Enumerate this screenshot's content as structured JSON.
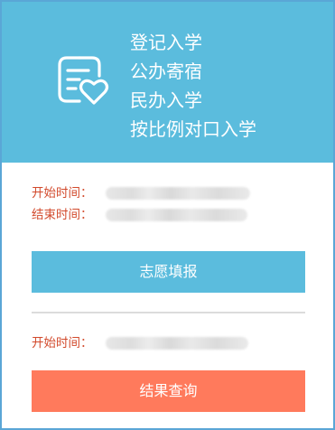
{
  "header": {
    "icon": "form-heart-icon",
    "lines": [
      "登记入学",
      "公办寄宿",
      "民办入学",
      "按比例对口入学"
    ]
  },
  "registration": {
    "start_label": "开始时间：",
    "end_label": "结束时间：",
    "button_label": "志愿填报"
  },
  "results": {
    "start_label": "开始时间：",
    "button_label": "结果查询"
  },
  "colors": {
    "header_bg": "#5bbcdd",
    "label_red": "#d24a2c",
    "primary_button": "#5bbcdd",
    "secondary_button": "#ff7a5c",
    "border": "#5aa6d6"
  }
}
